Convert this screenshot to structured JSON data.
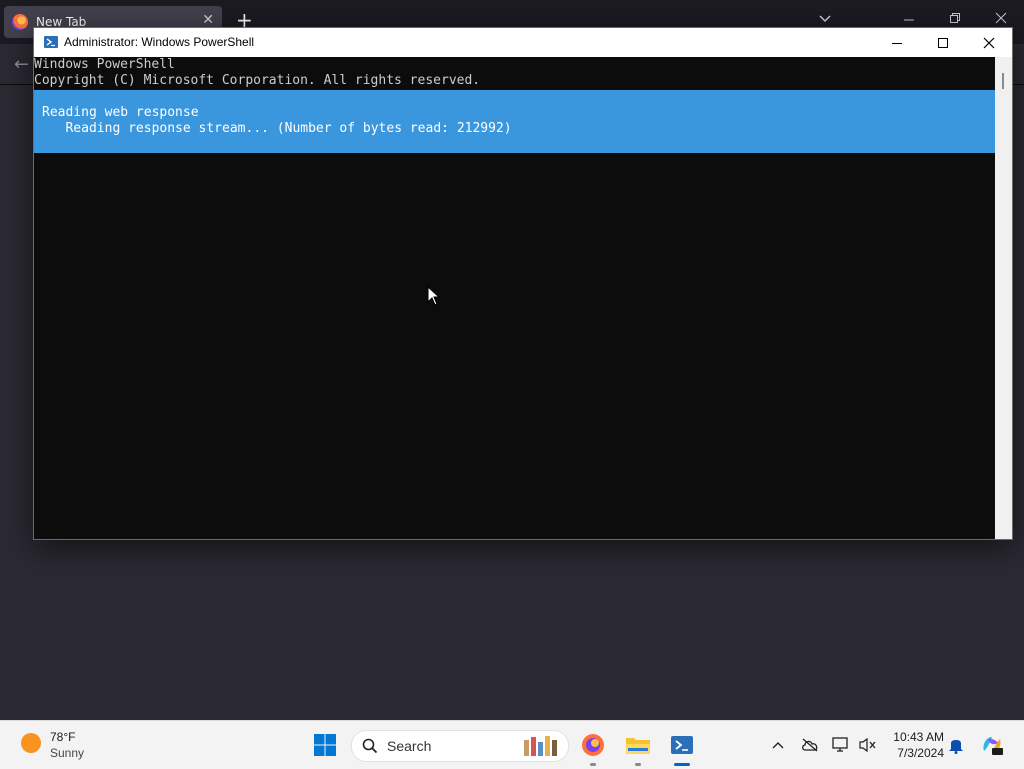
{
  "browser": {
    "tab_title": "New Tab",
    "tab_close": "✕",
    "new_tab": "+",
    "list_tabs": "⌄",
    "minimize": "—",
    "restore": "❐",
    "close": "✕",
    "back": "←"
  },
  "powershell": {
    "title": "Administrator: Windows PowerShell",
    "lines": [
      "Windows PowerShell",
      "Copyright (C) Microsoft Corporation. All rights reserved."
    ],
    "progress": {
      "activity": "Reading web response",
      "status": "   Reading response stream... (Number of bytes read: 212992)"
    }
  },
  "taskbar": {
    "weather": {
      "temp": "78°F",
      "condition": "Sunny"
    },
    "search": {
      "label": "Search"
    },
    "clock": {
      "time": "10:43 AM",
      "date": "7/3/2024"
    }
  },
  "colors": {
    "progress_banner": "#3a96dd",
    "console_bg": "#0c0c0c",
    "console_text": "#cccccc",
    "taskbar_bg": "#f3f3f3"
  }
}
